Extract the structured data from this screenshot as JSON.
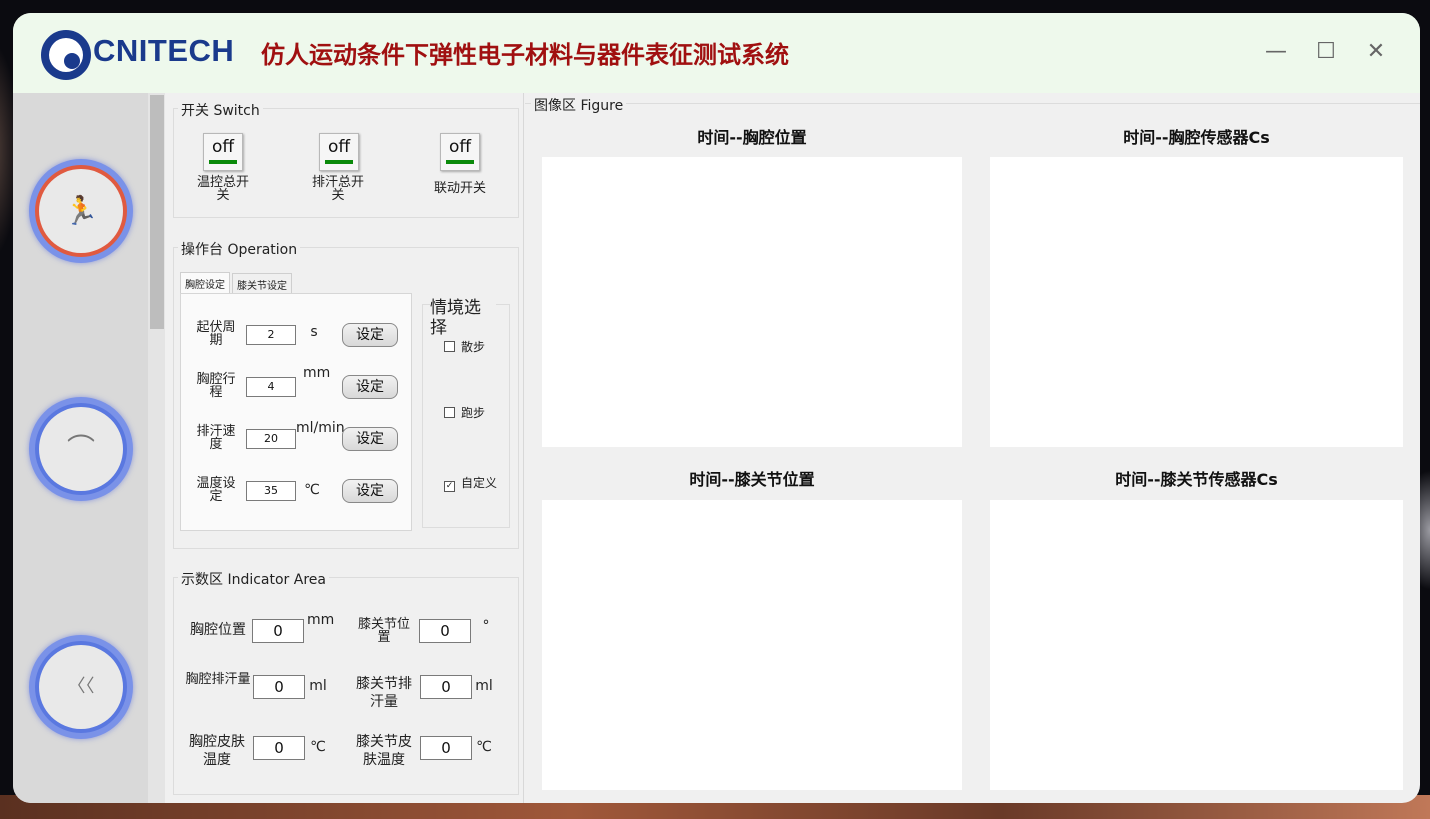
{
  "header": {
    "brand": "CNITECH",
    "title": "仿人运动条件下弹性电子材料与器件表征测试系统",
    "minimize_glyph": "—",
    "maximize_glyph": "☐",
    "close_glyph": "✕"
  },
  "sidebar": {
    "items": [
      {
        "icon": "running-person-icon",
        "glyph": "🏃",
        "active": true
      },
      {
        "icon": "chest-icon",
        "glyph": "⌒",
        "active": false
      },
      {
        "icon": "knee-icon",
        "glyph": "〈〈",
        "active": false
      }
    ]
  },
  "switch_group": {
    "title": "开关 Switch",
    "switches": [
      {
        "state": "off",
        "label": "温控总开关"
      },
      {
        "state": "off",
        "label": "排汗总开关"
      },
      {
        "state": "off",
        "label": "联动开关"
      }
    ]
  },
  "operation": {
    "title": "操作台 Operation",
    "tabs": [
      "胸腔设定",
      "膝关节设定"
    ],
    "rows": [
      {
        "label": "起伏周期",
        "value": "2",
        "unit": "s",
        "button": "设定"
      },
      {
        "label": "胸腔行程",
        "value": "4",
        "unit": "mm",
        "button": "设定"
      },
      {
        "label": "排汗速度",
        "value": "20",
        "unit": "ml/min",
        "button": "设定"
      },
      {
        "label": "温度设定",
        "value": "35",
        "unit": "℃",
        "button": "设定"
      }
    ],
    "scenario": {
      "title": "情境选择",
      "options": [
        {
          "label": "散步",
          "checked": false,
          "mark": ""
        },
        {
          "label": "跑步",
          "checked": false,
          "mark": ""
        },
        {
          "label": "自定义",
          "checked": true,
          "mark": "✓"
        }
      ]
    }
  },
  "indicator": {
    "title": "示数区 Indicator Area",
    "items": [
      {
        "label": "胸腔位置",
        "value": "0",
        "unit": "mm"
      },
      {
        "label": "膝关节位置",
        "value": "0",
        "unit": "°"
      },
      {
        "label": "胸腔排汗量",
        "value": "0",
        "unit": "ml"
      },
      {
        "label": "膝关节排汗量",
        "value": "0",
        "unit": "ml"
      },
      {
        "label": "胸腔皮肤温度",
        "value": "0",
        "unit": "℃"
      },
      {
        "label": "膝关节皮肤温度",
        "value": "0",
        "unit": "℃"
      }
    ]
  },
  "figure": {
    "title": "图像区 Figure",
    "plots": [
      {
        "title": "时间--胸腔位置"
      },
      {
        "title": "时间--胸腔传感器Cs"
      },
      {
        "title": "时间--膝关节位置"
      },
      {
        "title": "时间--膝关节传感器Cs"
      }
    ]
  }
}
